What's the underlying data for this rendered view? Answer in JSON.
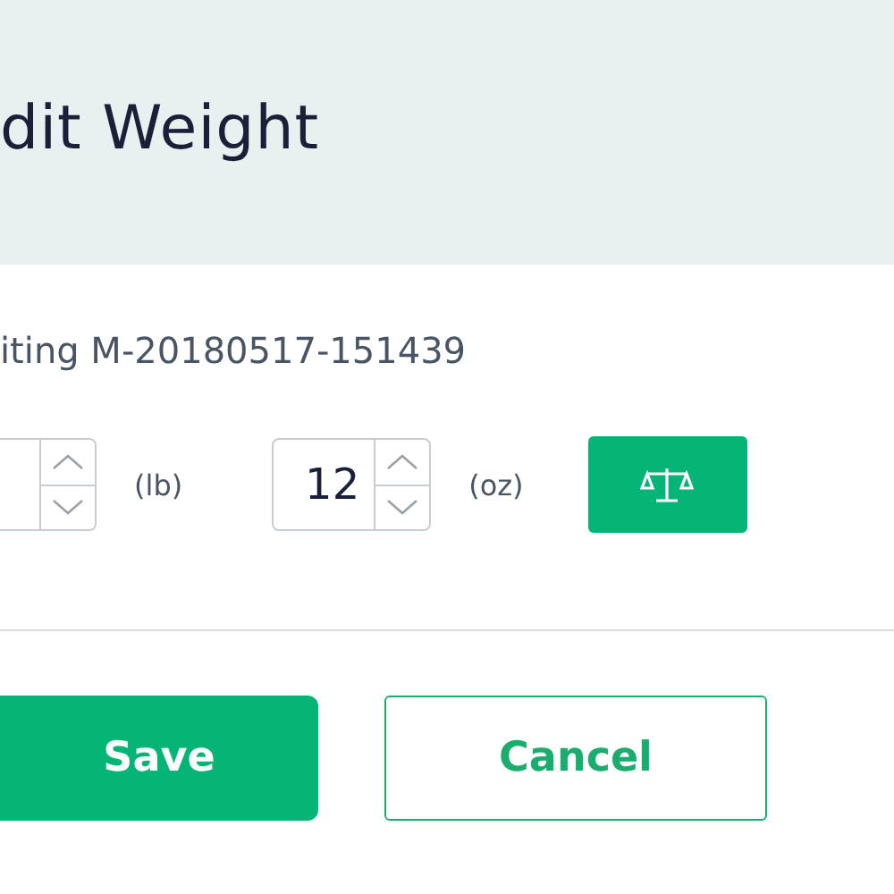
{
  "header": {
    "title": "dit Weight"
  },
  "subtitle": "iting M-20180517-151439",
  "weight": {
    "fields": [
      {
        "unit": "(lb)"
      },
      {
        "value": "12",
        "unit": "(oz)"
      }
    ]
  },
  "buttons": [
    {
      "label": "Save",
      "kind": "primary"
    },
    {
      "label": "Cancel",
      "kind": "secondary"
    }
  ]
}
